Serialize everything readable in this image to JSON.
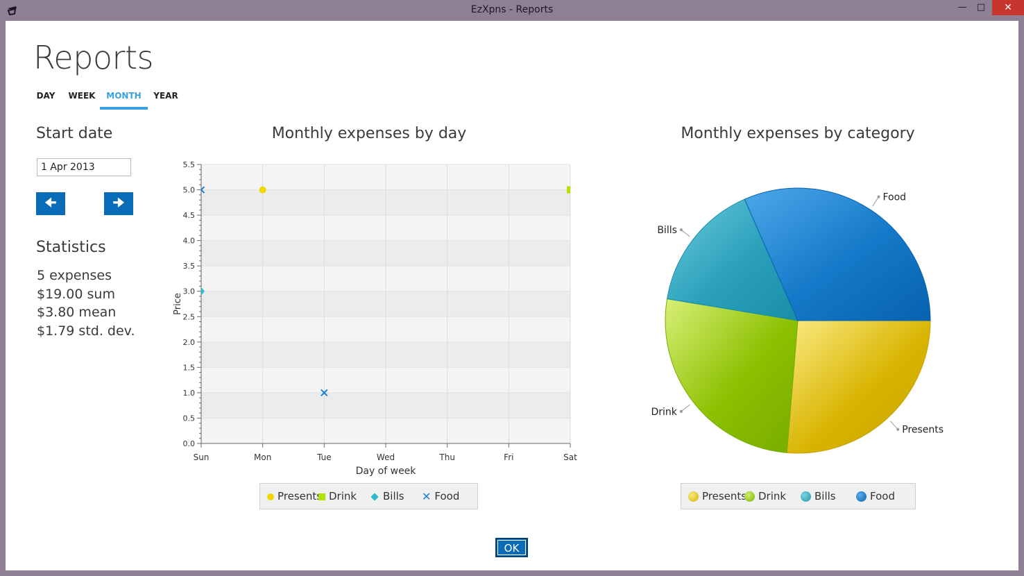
{
  "window": {
    "title": "EzXpns - Reports",
    "min_icon": "minimize-icon",
    "max_icon": "maximize-icon",
    "close_icon": "close-icon",
    "app_icon": "app-logo-icon"
  },
  "page": {
    "title": "Reports"
  },
  "tabs": [
    {
      "label": "DAY"
    },
    {
      "label": "WEEK"
    },
    {
      "label": "MONTH"
    },
    {
      "label": "YEAR"
    }
  ],
  "start_date": {
    "label": "Start date",
    "value": "1 Apr 2013"
  },
  "nav": {
    "prev_icon": "arrow-left-icon",
    "next_icon": "arrow-right-icon"
  },
  "statistics": {
    "label": "Statistics",
    "lines": [
      "5 expenses",
      "$19.00 sum",
      "$3.80 mean",
      "$1.79 std. dev."
    ]
  },
  "ok_label": "OK",
  "colors": {
    "accent": "#0a6bb7",
    "tab_active": "#3aa0e0",
    "presents": "#f2d600",
    "drink": "#b4e000",
    "bills": "#30b8cc",
    "food": "#1a7fd4"
  },
  "chart_data": [
    {
      "type": "scatter",
      "title": "Monthly expenses by day",
      "xlabel": "Day of week",
      "ylabel": "Price",
      "categories": [
        "Sun",
        "Mon",
        "Tue",
        "Wed",
        "Thu",
        "Fri",
        "Sat"
      ],
      "yticks": [
        "0.0",
        "0.5",
        "1.0",
        "1.5",
        "2.0",
        "2.5",
        "3.0",
        "3.5",
        "4.0",
        "4.5",
        "5.0",
        "5.5"
      ],
      "ylim": [
        0,
        5.5
      ],
      "grid": true,
      "legend": "bottom",
      "series": [
        {
          "name": "Presents",
          "symbol": "circle",
          "points": [
            {
              "x": "Mon",
              "y": 5.0
            }
          ]
        },
        {
          "name": "Drink",
          "symbol": "square",
          "points": [
            {
              "x": "Sat",
              "y": 5.0
            }
          ]
        },
        {
          "name": "Bills",
          "symbol": "diamond",
          "points": [
            {
              "x": "Sun",
              "y": 3.0
            }
          ]
        },
        {
          "name": "Food",
          "symbol": "cross",
          "points": [
            {
              "x": "Sun",
              "y": 5.0
            },
            {
              "x": "Tue",
              "y": 1.0
            }
          ]
        }
      ]
    },
    {
      "type": "pie",
      "title": "Monthly expenses by category",
      "legend": "bottom",
      "slices": [
        {
          "label": "Presents",
          "value": 5.0
        },
        {
          "label": "Drink",
          "value": 5.0
        },
        {
          "label": "Bills",
          "value": 3.0
        },
        {
          "label": "Food",
          "value": 6.0
        }
      ]
    }
  ]
}
